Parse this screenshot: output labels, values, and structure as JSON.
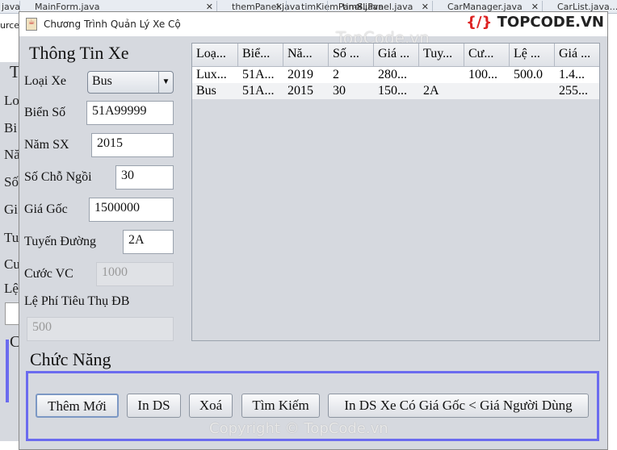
{
  "ide_tabs": [
    "java",
    "MainForm.java",
    "themPanel.java",
    "timKiemPanel.java",
    "timSLPanel.java",
    "CarManager.java",
    "CarList.java..."
  ],
  "ide_side": "urce",
  "bg_window_letters": [
    "T",
    "Lo",
    "Bi",
    "Nă",
    "Số",
    "Gi",
    "Tu",
    "Cu",
    "Lệ",
    "C"
  ],
  "window": {
    "title": "Chương Trình Quản Lý Xe Cộ"
  },
  "logo": {
    "text": "TOPCODE.VN"
  },
  "watermarks": {
    "top": "TopCode.vn",
    "bottom": "Copyright © TopCode.vn"
  },
  "form": {
    "heading": "Thông Tin Xe",
    "loai_xe": {
      "label": "Loại Xe",
      "value": "Bus"
    },
    "bien_so": {
      "label": "Biển Số",
      "value": "51A99999"
    },
    "nam_sx": {
      "label": "Năm SX",
      "value": "2015"
    },
    "so_cho": {
      "label": "Số Chỗ Ngồi",
      "value": "30"
    },
    "gia_goc": {
      "label": "Giá Gốc",
      "value": "1500000"
    },
    "tuyen": {
      "label": "Tuyến Đường",
      "value": "2A"
    },
    "cuoc": {
      "label": "Cước VC",
      "value": "1000"
    },
    "le_phi": {
      "label": "Lệ Phí Tiêu Thụ ĐB",
      "value": "500"
    }
  },
  "table": {
    "columns": [
      "Loạ...",
      "Biể...",
      "Nă...",
      "Số ...",
      "Giá ...",
      "Tuy...",
      "Cư...",
      "Lệ ...",
      "Giá ..."
    ],
    "rows": [
      [
        "Lux...",
        "51A...",
        "2019",
        "2",
        "280...",
        "",
        "100...",
        "500.0",
        "1.4..."
      ],
      [
        "Bus",
        "51A...",
        "2015",
        "30",
        "150...",
        "2A",
        "",
        "",
        "255..."
      ]
    ]
  },
  "functions": {
    "heading": "Chức Năng",
    "buttons": [
      "Thêm Mới",
      "In DS",
      "Xoá",
      "Tìm Kiếm",
      "In DS Xe Có Giá Gốc < Giá Người Dùng"
    ]
  },
  "colors": {
    "group_border": "#6b6bef",
    "panel_bg": "#d6d9df"
  }
}
